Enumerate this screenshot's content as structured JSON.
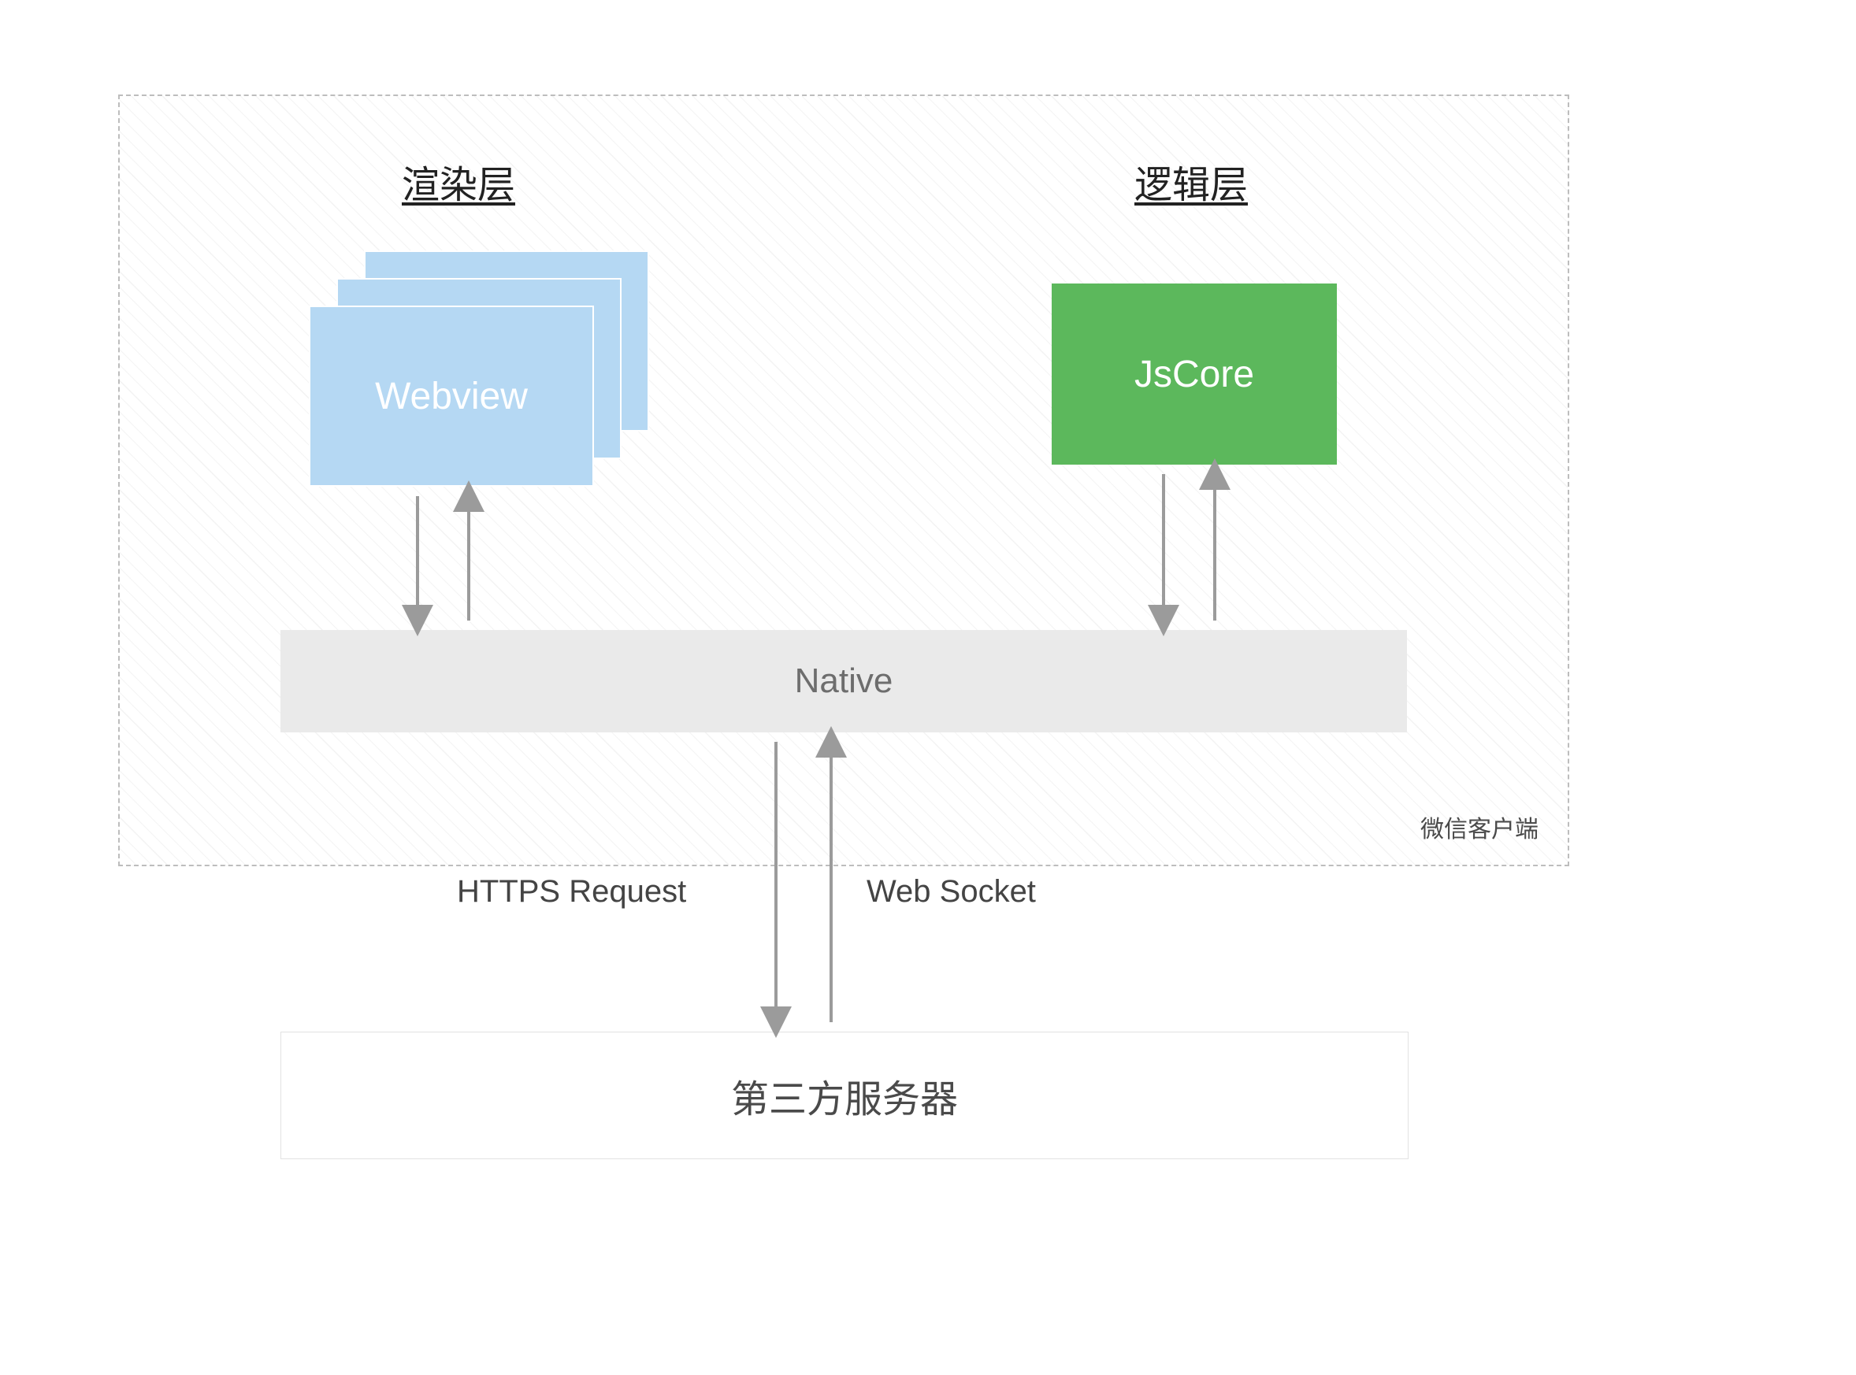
{
  "layers": {
    "render_heading": "渲染层",
    "logic_heading": "逻辑层"
  },
  "boxes": {
    "webview": "Webview",
    "jscore": "JsCore",
    "native": "Native",
    "server": "第三方服务器"
  },
  "labels": {
    "client": "微信客户端",
    "https": "HTTPS Request",
    "websocket": "Web Socket"
  },
  "colors": {
    "blue": "#b5d8f3",
    "green": "#5cb85c",
    "gray": "#eaeaea",
    "arrow": "#9b9b9b"
  }
}
